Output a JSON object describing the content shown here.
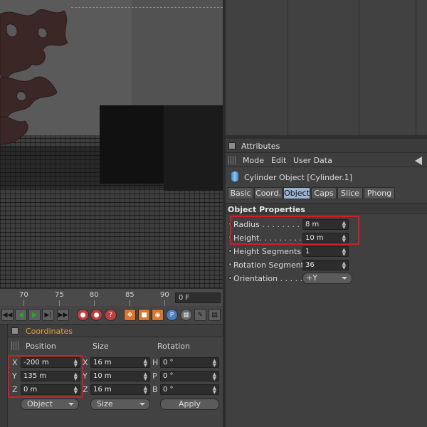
{
  "timeline": {
    "ticks": [
      "70",
      "75",
      "80",
      "85",
      "90"
    ],
    "current_frame": "0 F"
  },
  "coordinates": {
    "title": "Coordinates",
    "headers": {
      "position": "Position",
      "size": "Size",
      "rotation": "Rotation"
    },
    "axes": {
      "x": "X",
      "y": "Y",
      "z": "Z",
      "h": "H",
      "p": "P",
      "b": "B"
    },
    "position": {
      "x": "-200 m",
      "y": "135 m",
      "z": "0 m"
    },
    "size": {
      "x": "16 m",
      "y": "10 m",
      "z": "16 m"
    },
    "rotation": {
      "h": "0 °",
      "p": "0 °",
      "b": "0 °"
    },
    "mode_select": "Object",
    "size_select": "Size",
    "apply_label": "Apply"
  },
  "attributes": {
    "title": "Attributes",
    "menu": [
      "Mode",
      "Edit",
      "User Data"
    ],
    "object_title": "Cylinder Object [Cylinder.1]",
    "tabs": [
      "Basic",
      "Coord.",
      "Object",
      "Caps",
      "Slice",
      "Phong"
    ],
    "active_tab": "Object",
    "section_title": "Object Properties",
    "props": {
      "radius_label": "Radius . . . . . . . . . .",
      "radius_value": "8 m",
      "height_label": "Height. . . . . . . . . .",
      "height_value": "10 m",
      "height_segments_label": "Height Segments",
      "height_segments_value": "1",
      "rotation_segments_label": "Rotation Segments",
      "rotation_segments_value": "36",
      "orientation_label": "Orientation . . . . . .",
      "orientation_value": "+Y"
    }
  },
  "icons": {
    "transport": [
      "skip-start-icon",
      "step-back-icon",
      "play-back-icon",
      "play-forward-icon",
      "step-forward-icon",
      "skip-end-icon",
      "record-icon",
      "autokey-icon",
      "help-key-icon",
      "move-key-icon",
      "scale-key-icon",
      "rotate-key-icon",
      "param-key-icon",
      "pla-key-icon"
    ]
  },
  "colors": {
    "highlight": "#d11e22",
    "section_title": "#e3a23b",
    "active_tab": "#9bb3d2"
  }
}
